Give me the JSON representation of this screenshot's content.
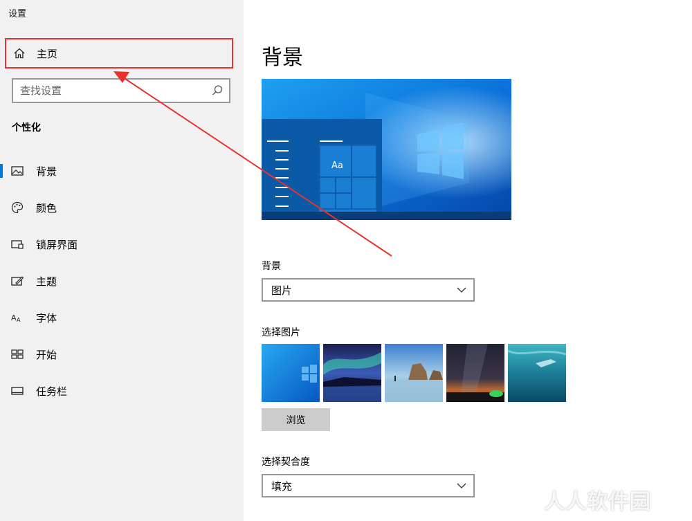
{
  "app_title": "设置",
  "sidebar": {
    "home_label": "主页",
    "search_placeholder": "查找设置",
    "section_title": "个性化",
    "items": [
      {
        "label": "背景",
        "icon": "picture-icon"
      },
      {
        "label": "颜色",
        "icon": "palette-icon"
      },
      {
        "label": "锁屏界面",
        "icon": "lock-screen-icon"
      },
      {
        "label": "主题",
        "icon": "theme-icon"
      },
      {
        "label": "字体",
        "icon": "font-icon"
      },
      {
        "label": "开始",
        "icon": "start-icon"
      },
      {
        "label": "任务栏",
        "icon": "taskbar-icon"
      }
    ]
  },
  "main": {
    "title": "背景",
    "preview_sample_text": "Aa",
    "background_label": "背景",
    "background_value": "图片",
    "choose_picture_label": "选择图片",
    "browse_label": "浏览",
    "fit_label": "选择契合度",
    "fit_value": "填充"
  },
  "watermark": "人人软件园",
  "colors": {
    "accent": "#0078d7",
    "highlight": "#e8322d"
  }
}
